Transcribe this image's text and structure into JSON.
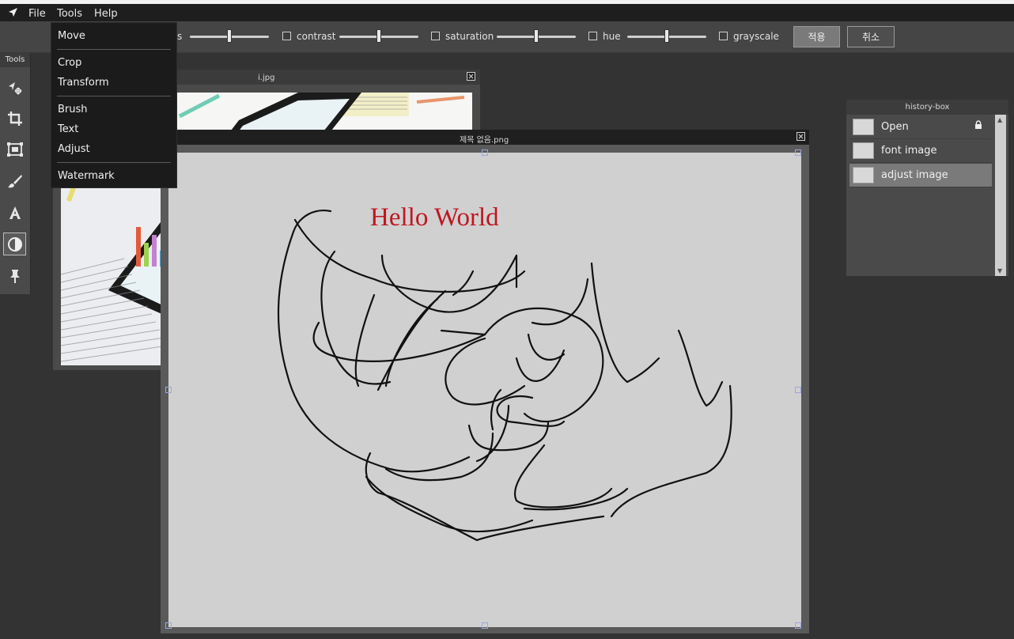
{
  "menubar": {
    "logo_icon": "cursor-arrow-icon",
    "items": [
      "File",
      "Tools",
      "Help"
    ]
  },
  "adjust": {
    "cut_label": "s",
    "contrast_label": "contrast",
    "saturation_label": "saturation",
    "hue_label": "hue",
    "grayscale_label": "grayscale",
    "brightness_level": 0.5,
    "contrast_level": 0.5,
    "saturation_level": 0.5,
    "hue_level": 0.5,
    "apply_label": "적용",
    "cancel_label": "취소"
  },
  "tools_panel": {
    "title": "Tools",
    "buttons": [
      "move-tool-icon",
      "crop-tool-icon",
      "transform-tool-icon",
      "brush-tool-icon",
      "text-tool-icon",
      "adjust-tool-icon",
      "watermark-tool-icon"
    ],
    "active": "adjust-tool-icon"
  },
  "tools_menu": {
    "items": [
      "Move",
      "Crop",
      "Transform",
      "Brush",
      "Text",
      "Adjust",
      "Watermark"
    ]
  },
  "windows": {
    "back": {
      "title": "i.jpg"
    },
    "front": {
      "title": "제목 없음.png",
      "canvas_text": "Hello World",
      "text_color": "#c0161f"
    }
  },
  "history": {
    "title": "history-box",
    "items": [
      {
        "label": "Open",
        "locked": true
      },
      {
        "label": "font image",
        "locked": false
      },
      {
        "label": "adjust image",
        "locked": false,
        "selected": true
      }
    ]
  },
  "colors": {
    "background": "#333333",
    "menubar": "#1e1e1e",
    "canvas": "#d0d0d0",
    "selected_history": "#7a7a7a"
  }
}
